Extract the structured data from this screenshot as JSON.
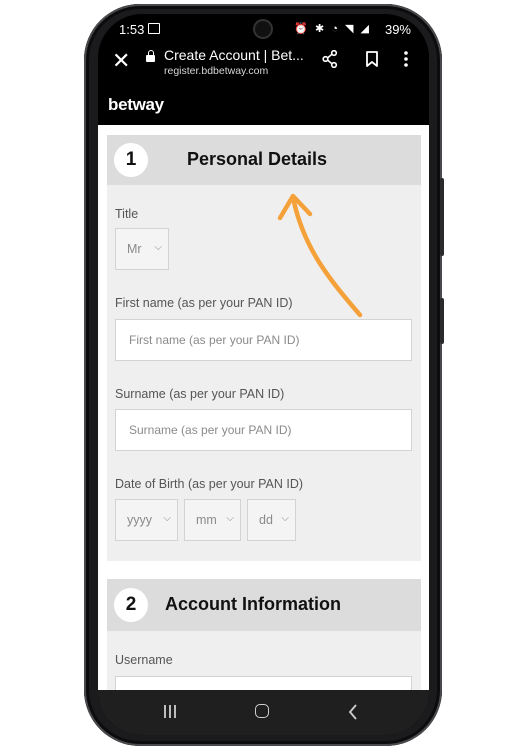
{
  "status_bar": {
    "time": "1:53",
    "icons": "⏰ ✱ ◔ ◥ ◢",
    "battery": "39%"
  },
  "browser": {
    "title": "Create Account | Bet...",
    "url": "register.bdbetway.com"
  },
  "site": {
    "logo": "betway"
  },
  "sections": [
    {
      "number": "1",
      "title": "Personal Details",
      "title_field": {
        "label": "Title",
        "value": "Mr"
      },
      "first_name": {
        "label": "First name (as per your PAN ID)",
        "placeholder": "First name (as per your PAN ID)"
      },
      "surname": {
        "label": "Surname (as per your PAN ID)",
        "placeholder": "Surname (as per your PAN ID)"
      },
      "dob": {
        "label": "Date of Birth (as per your PAN ID)",
        "year": "yyyy",
        "month": "mm",
        "day": "dd"
      }
    },
    {
      "number": "2",
      "title": "Account Information",
      "username": {
        "label": "Username"
      }
    }
  ],
  "colors": {
    "annotation_arrow": "#f5a13a",
    "header_bg": "#000000",
    "card_bg": "#efefef",
    "card_head_bg": "#dcdcdc"
  }
}
